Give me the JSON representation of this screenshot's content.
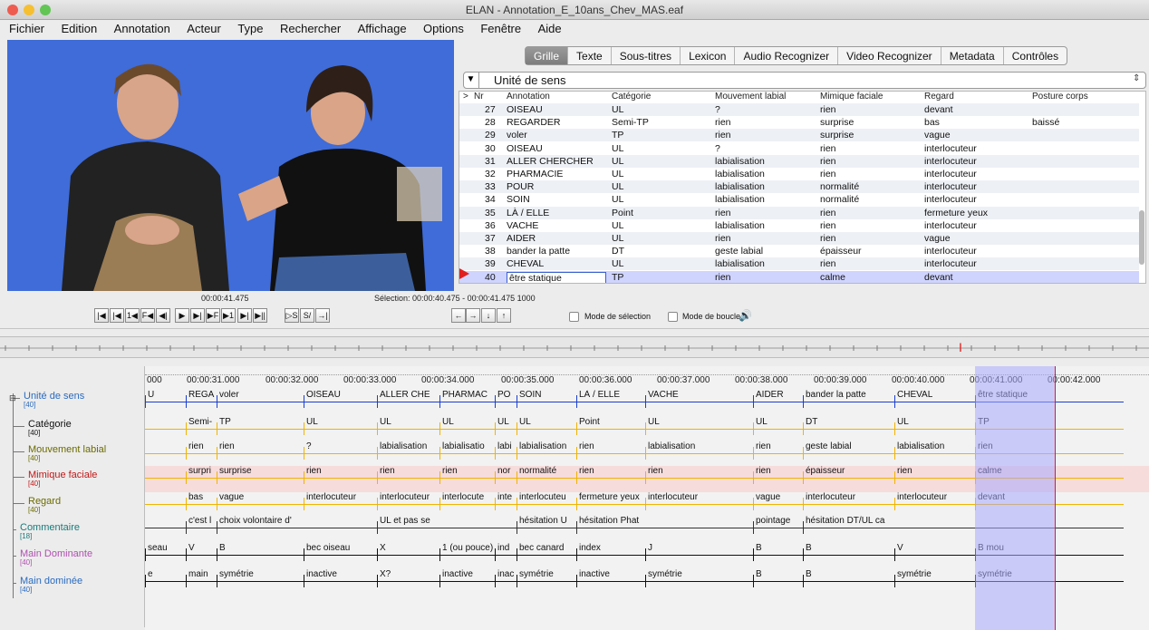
{
  "window": {
    "title": "ELAN - Annotation_E_10ans_Chev_MAS.eaf"
  },
  "menu": [
    "Fichier",
    "Edition",
    "Annotation",
    "Acteur",
    "Type",
    "Rechercher",
    "Affichage",
    "Options",
    "Fenêtre",
    "Aide"
  ],
  "tabs": [
    "Grille",
    "Texte",
    "Sous-titres",
    "Lexicon",
    "Audio Recognizer",
    "Video Recognizer",
    "Metadata",
    "Contrôles"
  ],
  "active_tab": "Grille",
  "tier_selector": {
    "value": "Unité de sens"
  },
  "grid": {
    "columns": [
      ">",
      "Nr",
      "Annotation",
      "Catégorie",
      "Mouvement labial",
      "Mimique faciale",
      "Regard",
      "Posture corps"
    ],
    "rows": [
      {
        "nr": "27",
        "annotation": "OISEAU",
        "categorie": "UL",
        "mouvement": "?",
        "mimique": "rien",
        "regard": "devant",
        "posture": ""
      },
      {
        "nr": "28",
        "annotation": "REGARDER",
        "categorie": "Semi-TP",
        "mouvement": "rien",
        "mimique": "surprise",
        "regard": "bas",
        "posture": "baissé"
      },
      {
        "nr": "29",
        "annotation": "voler",
        "categorie": "TP",
        "mouvement": "rien",
        "mimique": "surprise",
        "regard": "vague",
        "posture": ""
      },
      {
        "nr": "30",
        "annotation": "OISEAU",
        "categorie": "UL",
        "mouvement": "?",
        "mimique": "rien",
        "regard": "interlocuteur",
        "posture": ""
      },
      {
        "nr": "31",
        "annotation": "ALLER CHERCHER",
        "categorie": "UL",
        "mouvement": "labialisation",
        "mimique": "rien",
        "regard": "interlocuteur",
        "posture": ""
      },
      {
        "nr": "32",
        "annotation": "PHARMACIE",
        "categorie": "UL",
        "mouvement": "labialisation",
        "mimique": "rien",
        "regard": "interlocuteur",
        "posture": ""
      },
      {
        "nr": "33",
        "annotation": "POUR",
        "categorie": "UL",
        "mouvement": "labialisation",
        "mimique": "normalité",
        "regard": "interlocuteur",
        "posture": ""
      },
      {
        "nr": "34",
        "annotation": "SOIN",
        "categorie": "UL",
        "mouvement": "labialisation",
        "mimique": "normalité",
        "regard": "interlocuteur",
        "posture": ""
      },
      {
        "nr": "35",
        "annotation": "LÀ / ELLE",
        "categorie": "Point",
        "mouvement": "rien",
        "mimique": "rien",
        "regard": "fermeture yeux",
        "posture": ""
      },
      {
        "nr": "36",
        "annotation": "VACHE",
        "categorie": "UL",
        "mouvement": "labialisation",
        "mimique": "rien",
        "regard": "interlocuteur",
        "posture": ""
      },
      {
        "nr": "37",
        "annotation": "AIDER",
        "categorie": "UL",
        "mouvement": "rien",
        "mimique": "rien",
        "regard": "vague",
        "posture": ""
      },
      {
        "nr": "38",
        "annotation": "bander la patte",
        "categorie": "DT",
        "mouvement": "geste labial",
        "mimique": "épaisseur",
        "regard": "interlocuteur",
        "posture": ""
      },
      {
        "nr": "39",
        "annotation": "CHEVAL",
        "categorie": "UL",
        "mouvement": "labialisation",
        "mimique": "rien",
        "regard": "interlocuteur",
        "posture": ""
      },
      {
        "nr": "40",
        "annotation": "être statique",
        "categorie": "TP",
        "mouvement": "rien",
        "mimique": "calme",
        "regard": "devant",
        "posture": ""
      }
    ]
  },
  "transport": {
    "timecode": "00:00:41.475",
    "selection": "Sélection: 00:00:40.475 - 00:00:41.475  1000",
    "mode_selection": "Mode de sélection",
    "mode_boucle": "Mode de boucle"
  },
  "ruler_ticks": [
    "000",
    "00:00:31.000",
    "00:00:32.000",
    "00:00:33.000",
    "00:00:34.000",
    "00:00:35.000",
    "00:00:36.000",
    "00:00:37.000",
    "00:00:38.000",
    "00:00:39.000",
    "00:00:40.000",
    "00:00:41.000",
    "00:00:42.000"
  ],
  "tiers": [
    {
      "name": "Unité de sens",
      "count": "[40]",
      "color": "#2a6bbf",
      "line": "#1a3fcf",
      "anns": [
        "U",
        "REGA",
        "voler",
        "OISEAU",
        "ALLER CHE",
        "PHARMAC",
        "PO",
        "SOIN",
        "LÀ / ELLE",
        "VACHE",
        "AIDER",
        "bander la patte",
        "CHEVAL",
        "être statique"
      ]
    },
    {
      "name": "Catégorie",
      "count": "[40]",
      "color": "#111",
      "line": "#f0b400",
      "anns": [
        "Semi-",
        "TP",
        "UL",
        "UL",
        "UL",
        "UL",
        "UL",
        "Point",
        "UL",
        "UL",
        "DT",
        "UL",
        "TP"
      ]
    },
    {
      "name": "Mouvement labial",
      "count": "[40]",
      "color": "#6b6b00",
      "line": "#f0b400",
      "anns": [
        "rien",
        "rien",
        "?",
        "labialisation",
        "labialisatio",
        "labi",
        "labialisation",
        "rien",
        "labialisation",
        "rien",
        "geste labial",
        "labialisation",
        "rien"
      ]
    },
    {
      "name": "Mimique faciale",
      "count": "[40]",
      "color": "#c01818",
      "line": "#f0b400",
      "anns": [
        "surpri",
        "surprise",
        "rien",
        "rien",
        "rien",
        "nor",
        "normalité",
        "rien",
        "rien",
        "rien",
        "épaisseur",
        "rien",
        "calme"
      ]
    },
    {
      "name": "Regard",
      "count": "[40]",
      "color": "#6b6b00",
      "line": "#f0b400",
      "anns": [
        "bas",
        "vague",
        "interlocuteur",
        "interlocuteur",
        "interlocute",
        "inte",
        "interlocuteu",
        "fermeture yeux",
        "interlocuteur",
        "vague",
        "interlocuteur",
        "interlocuteur",
        "devant"
      ]
    },
    {
      "name": "Commentaire",
      "count": "[18]",
      "color": "#1a7a7a",
      "line": "#333",
      "anns": [
        "c'est l",
        "choix volontaire d'",
        "UL et pas se",
        "hésitation U",
        "hésitation Phat",
        "pointage",
        "hésitation DT/UL ca"
      ]
    },
    {
      "name": "Main Dominante",
      "count": "[40]",
      "color": "#b050b0",
      "line": "#111",
      "anns": [
        "seau",
        "V",
        "B",
        "bec oiseau",
        "X",
        "1 (ou pouce)",
        "ind",
        "bec canard",
        "index",
        "J",
        "B",
        "B",
        "V",
        "B mou"
      ]
    },
    {
      "name": "Main dominée",
      "count": "[40]",
      "color": "#2a6bbf",
      "line": "#111",
      "anns": [
        "e",
        "main",
        "symétrie",
        "inactive",
        "X?",
        "inactive",
        "inac",
        "symétrie",
        "inactive",
        "symétrie",
        "B",
        "B",
        "symétrie",
        "symétrie"
      ]
    }
  ]
}
